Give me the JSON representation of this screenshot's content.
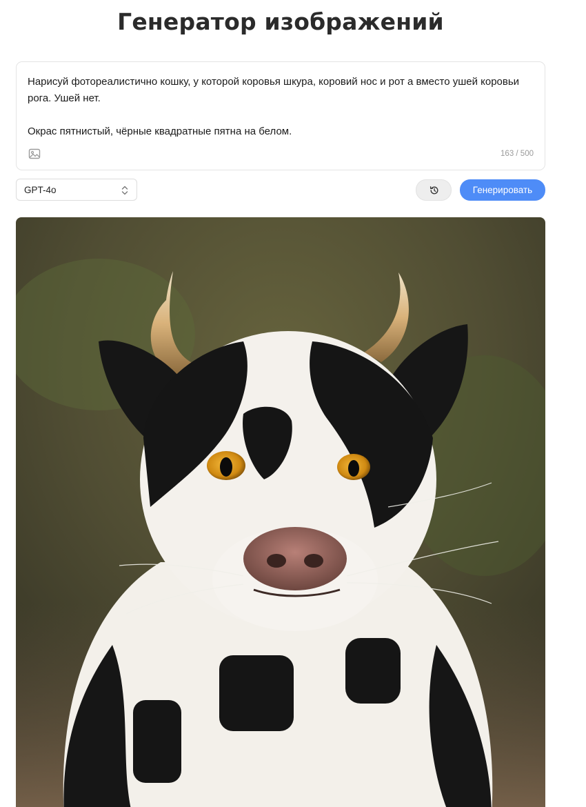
{
  "header": {
    "title": "Генератор изображений"
  },
  "prompt": {
    "text": "Нарисуй фотореалистично кошку, у которой коровья шкура, коровий нос и рот а вместо ушей коровьи рога. Ушей нет.\n\nОкрас пятнистый, чёрные квадратные пятна на белом.",
    "counter": "163 / 500",
    "attach_icon": "image-icon"
  },
  "controls": {
    "model": "GPT-4o",
    "history_icon": "history-icon",
    "generate_label": "Генерировать",
    "accent": "#4e8cf7"
  },
  "result": {
    "alt": "Фотореалистичная кошка с коровьим окрасом, коровьим носом и рогами",
    "palette": {
      "background": "#5a5637",
      "fur_white": "#f4f1ec",
      "fur_black": "#141414",
      "eyes": "#e3a01e",
      "horns": "#d8b27a",
      "nose": "#9a6a63"
    }
  }
}
